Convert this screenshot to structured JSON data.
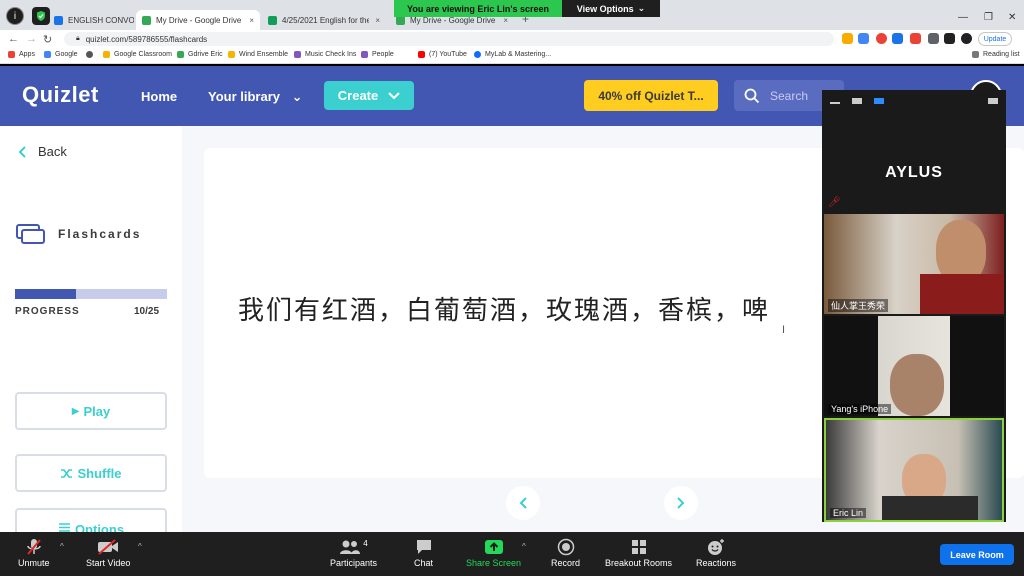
{
  "tabs": [
    {
      "label": "ENGLISH CONVO 12 ...",
      "color": "#1a73e8"
    },
    {
      "label": "My Drive - Google Drive",
      "color": "#34a853"
    },
    {
      "label": "4/25/2021 English for the Elderly",
      "color": "#0f9d58"
    },
    {
      "label": "My Drive - Google Drive",
      "color": "#34a853"
    }
  ],
  "zoom_banner": {
    "viewing": "You are viewing Eric Lin's screen",
    "view_options": "View Options"
  },
  "browser": {
    "url": "quizlet.com/589786555/flashcards",
    "update_label": "Update",
    "reading_list": "Reading list"
  },
  "bookmarks": [
    {
      "label": "Apps",
      "color": "#ea4335"
    },
    {
      "label": "Google",
      "color": "#4285f4"
    },
    {
      "label": "",
      "color": "#555555"
    },
    {
      "label": "Google Classroom",
      "color": "#f4b400"
    },
    {
      "label": "Gdrive Eric",
      "color": "#34a853"
    },
    {
      "label": "Wind Ensemble",
      "color": "#f4b400"
    },
    {
      "label": "Music Check Ins",
      "color": "#7e57c2"
    },
    {
      "label": "People",
      "color": "#7e57c2"
    },
    {
      "label": "(7) YouTube",
      "color": "#ff0000"
    },
    {
      "label": "MyLab & Mastering...",
      "color": "#0d6efd"
    }
  ],
  "quizlet": {
    "logo": "Quizlet",
    "home": "Home",
    "library": "Your library",
    "create": "Create",
    "promo": "40% off Quizlet T...",
    "search_placeholder": "Search"
  },
  "sidebar": {
    "back": "Back",
    "mode": "Flashcards",
    "progress_label": "PROGRESS",
    "progress_current": 10,
    "progress_total": 25,
    "progress_text": "10/25",
    "play": "Play",
    "shuffle": "Shuffle",
    "options": "Options"
  },
  "card": {
    "text": "我们有红酒，白葡萄酒，玫瑰酒，香槟，啤"
  },
  "gallery": {
    "host_name": "AYLUS",
    "participants": [
      {
        "name": "仙人掌王秀荣"
      },
      {
        "name": "Yang's iPhone"
      },
      {
        "name": "Eric Lin"
      }
    ]
  },
  "zoom_toolbar": {
    "unmute": "Unmute",
    "start_video": "Start Video",
    "participants": "Participants",
    "participants_count": "4",
    "chat": "Chat",
    "share_screen": "Share Screen",
    "record": "Record",
    "breakout_rooms": "Breakout Rooms",
    "reactions": "Reactions",
    "leave_room": "Leave Room"
  }
}
